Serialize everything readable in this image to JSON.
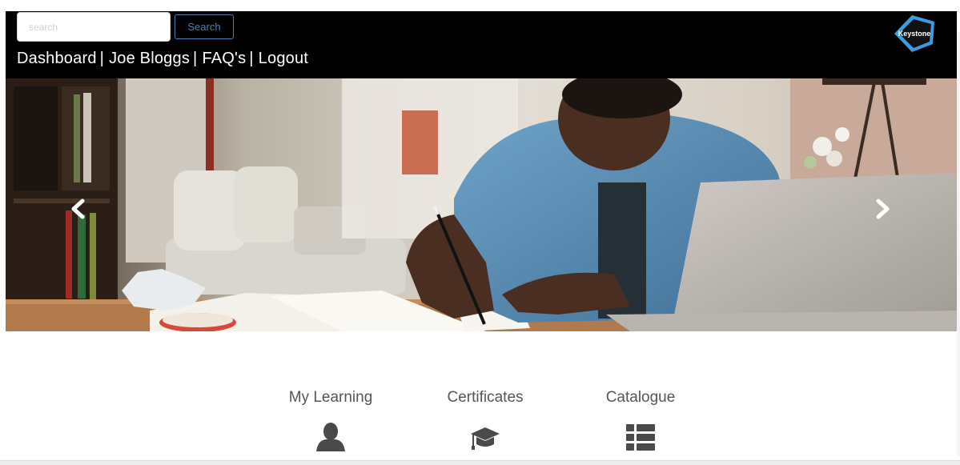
{
  "header": {
    "search_placeholder": "search",
    "search_button_label": "Search",
    "nav": {
      "dashboard": "Dashboard",
      "user": "Joe Bloggs",
      "faqs": "FAQ's",
      "logout": "Logout",
      "separator": "|"
    },
    "logo_text": "Keystone"
  },
  "hero": {
    "prev_icon": "chevron-left-icon",
    "next_icon": "chevron-right-icon"
  },
  "tiles": [
    {
      "label": "My Learning",
      "icon": "user-icon"
    },
    {
      "label": "Certificates",
      "icon": "graduation-cap-icon"
    },
    {
      "label": "Catalogue",
      "icon": "list-icon"
    }
  ],
  "colors": {
    "header_bg": "#000000",
    "search_button_border": "#4c7fb0",
    "nav_text": "#ffffff",
    "tile_text": "#555555",
    "tile_icon": "#4a4a4a",
    "logo_accent": "#3d9be0"
  }
}
